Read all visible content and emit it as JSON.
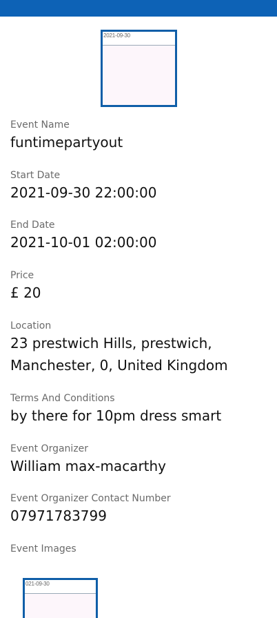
{
  "header": {
    "bar_color": "#0d62b6"
  },
  "top_image": {
    "date_caption": "2021-09-30"
  },
  "fields": [
    {
      "label": "Event Name",
      "value": "funtimepartyout"
    },
    {
      "label": "Start Date",
      "value": "2021-09-30 22:00:00"
    },
    {
      "label": "End Date",
      "value": "2021-10-01 02:00:00"
    },
    {
      "label": "Price",
      "value": "£ 20"
    },
    {
      "label": "Location",
      "value": "23 prestwich Hills, prestwich,\nManchester, 0, United Kingdom"
    },
    {
      "label": "Terms And Conditions",
      "value": "by there for 10pm dress smart"
    },
    {
      "label": "Event Organizer",
      "value": "William max-macarthy"
    },
    {
      "label": "Event Organizer Contact Number",
      "value": "07971783799"
    }
  ],
  "event_images": {
    "label": "Event Images",
    "items": [
      {
        "date_caption": "021-09-30"
      }
    ]
  }
}
